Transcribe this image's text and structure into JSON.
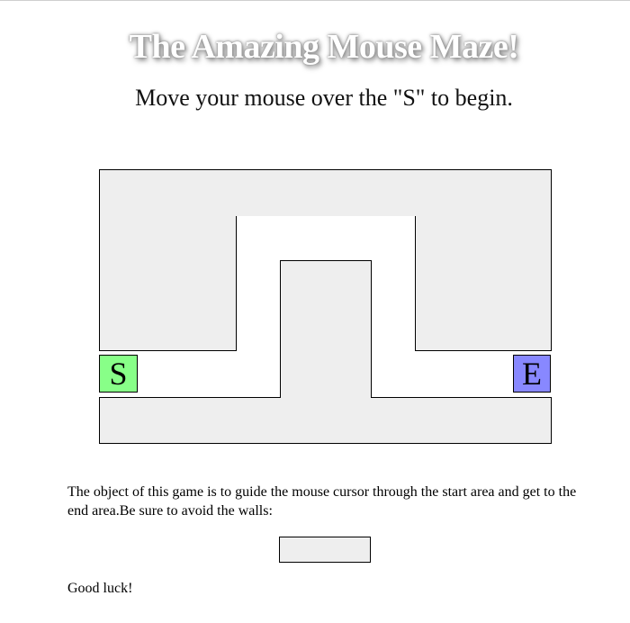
{
  "header": {
    "title": "The Amazing Mouse Maze!",
    "instruction": "Move your mouse over the \"S\" to begin."
  },
  "maze": {
    "start_label": "S",
    "end_label": "E",
    "colors": {
      "wall": "#eeeeee",
      "start": "#88ff88",
      "end": "#8888ff"
    }
  },
  "footer": {
    "description": "The object of this game is to guide the mouse cursor through the start area and get to the end area.Be sure to avoid the walls:",
    "closing": "Good luck!"
  }
}
